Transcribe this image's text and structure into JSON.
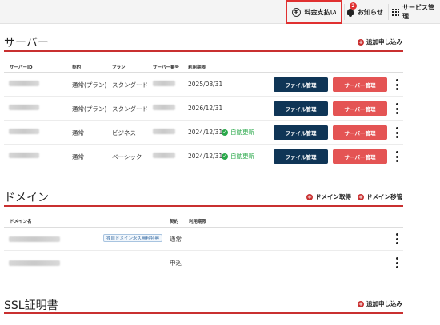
{
  "topbar": {
    "pay_label": "料金支払い",
    "notice_label": "お知らせ",
    "notice_badge": "2",
    "service_label": "サービス管理",
    "icons": {
      "pay": "yen-circle-icon",
      "notice": "bell-icon",
      "service": "grid-icon"
    }
  },
  "servers": {
    "title": "サーバー",
    "add_label": "追加申し込み",
    "columns": [
      "サーバーID",
      "契約",
      "プラン",
      "サーバー番号",
      "利用期限"
    ],
    "rows": [
      {
        "contract": "通常(プラン)",
        "plan": "スタンダード",
        "expiry": "2025/08/31",
        "auto_renew": ""
      },
      {
        "contract": "通常(プラン)",
        "plan": "スタンダード",
        "expiry": "2026/12/31",
        "auto_renew": ""
      },
      {
        "contract": "通常",
        "plan": "ビジネス",
        "expiry": "2024/12/31",
        "auto_renew": "自動更新"
      },
      {
        "contract": "通常",
        "plan": "ベーシック",
        "expiry": "2024/12/31",
        "auto_renew": "自動更新"
      }
    ],
    "file_button": "ファイル管理",
    "server_button": "サーバー管理"
  },
  "domains": {
    "title": "ドメイン",
    "acquire_label": "ドメイン取得",
    "transfer_label": "ドメイン移管",
    "columns": [
      "ドメイン名",
      "契約",
      "利用期限"
    ],
    "rows": [
      {
        "promo": "独自ドメイン永久無料特典",
        "status": "通常"
      },
      {
        "promo": "",
        "status": "申込"
      }
    ]
  },
  "ssl": {
    "title": "SSL証明書",
    "add_label": "追加申し込み"
  },
  "colors": {
    "accent_red": "#c93030",
    "file_button": "#0f3556",
    "server_button": "#e45454",
    "auto_renew_green": "#2aa84a"
  }
}
